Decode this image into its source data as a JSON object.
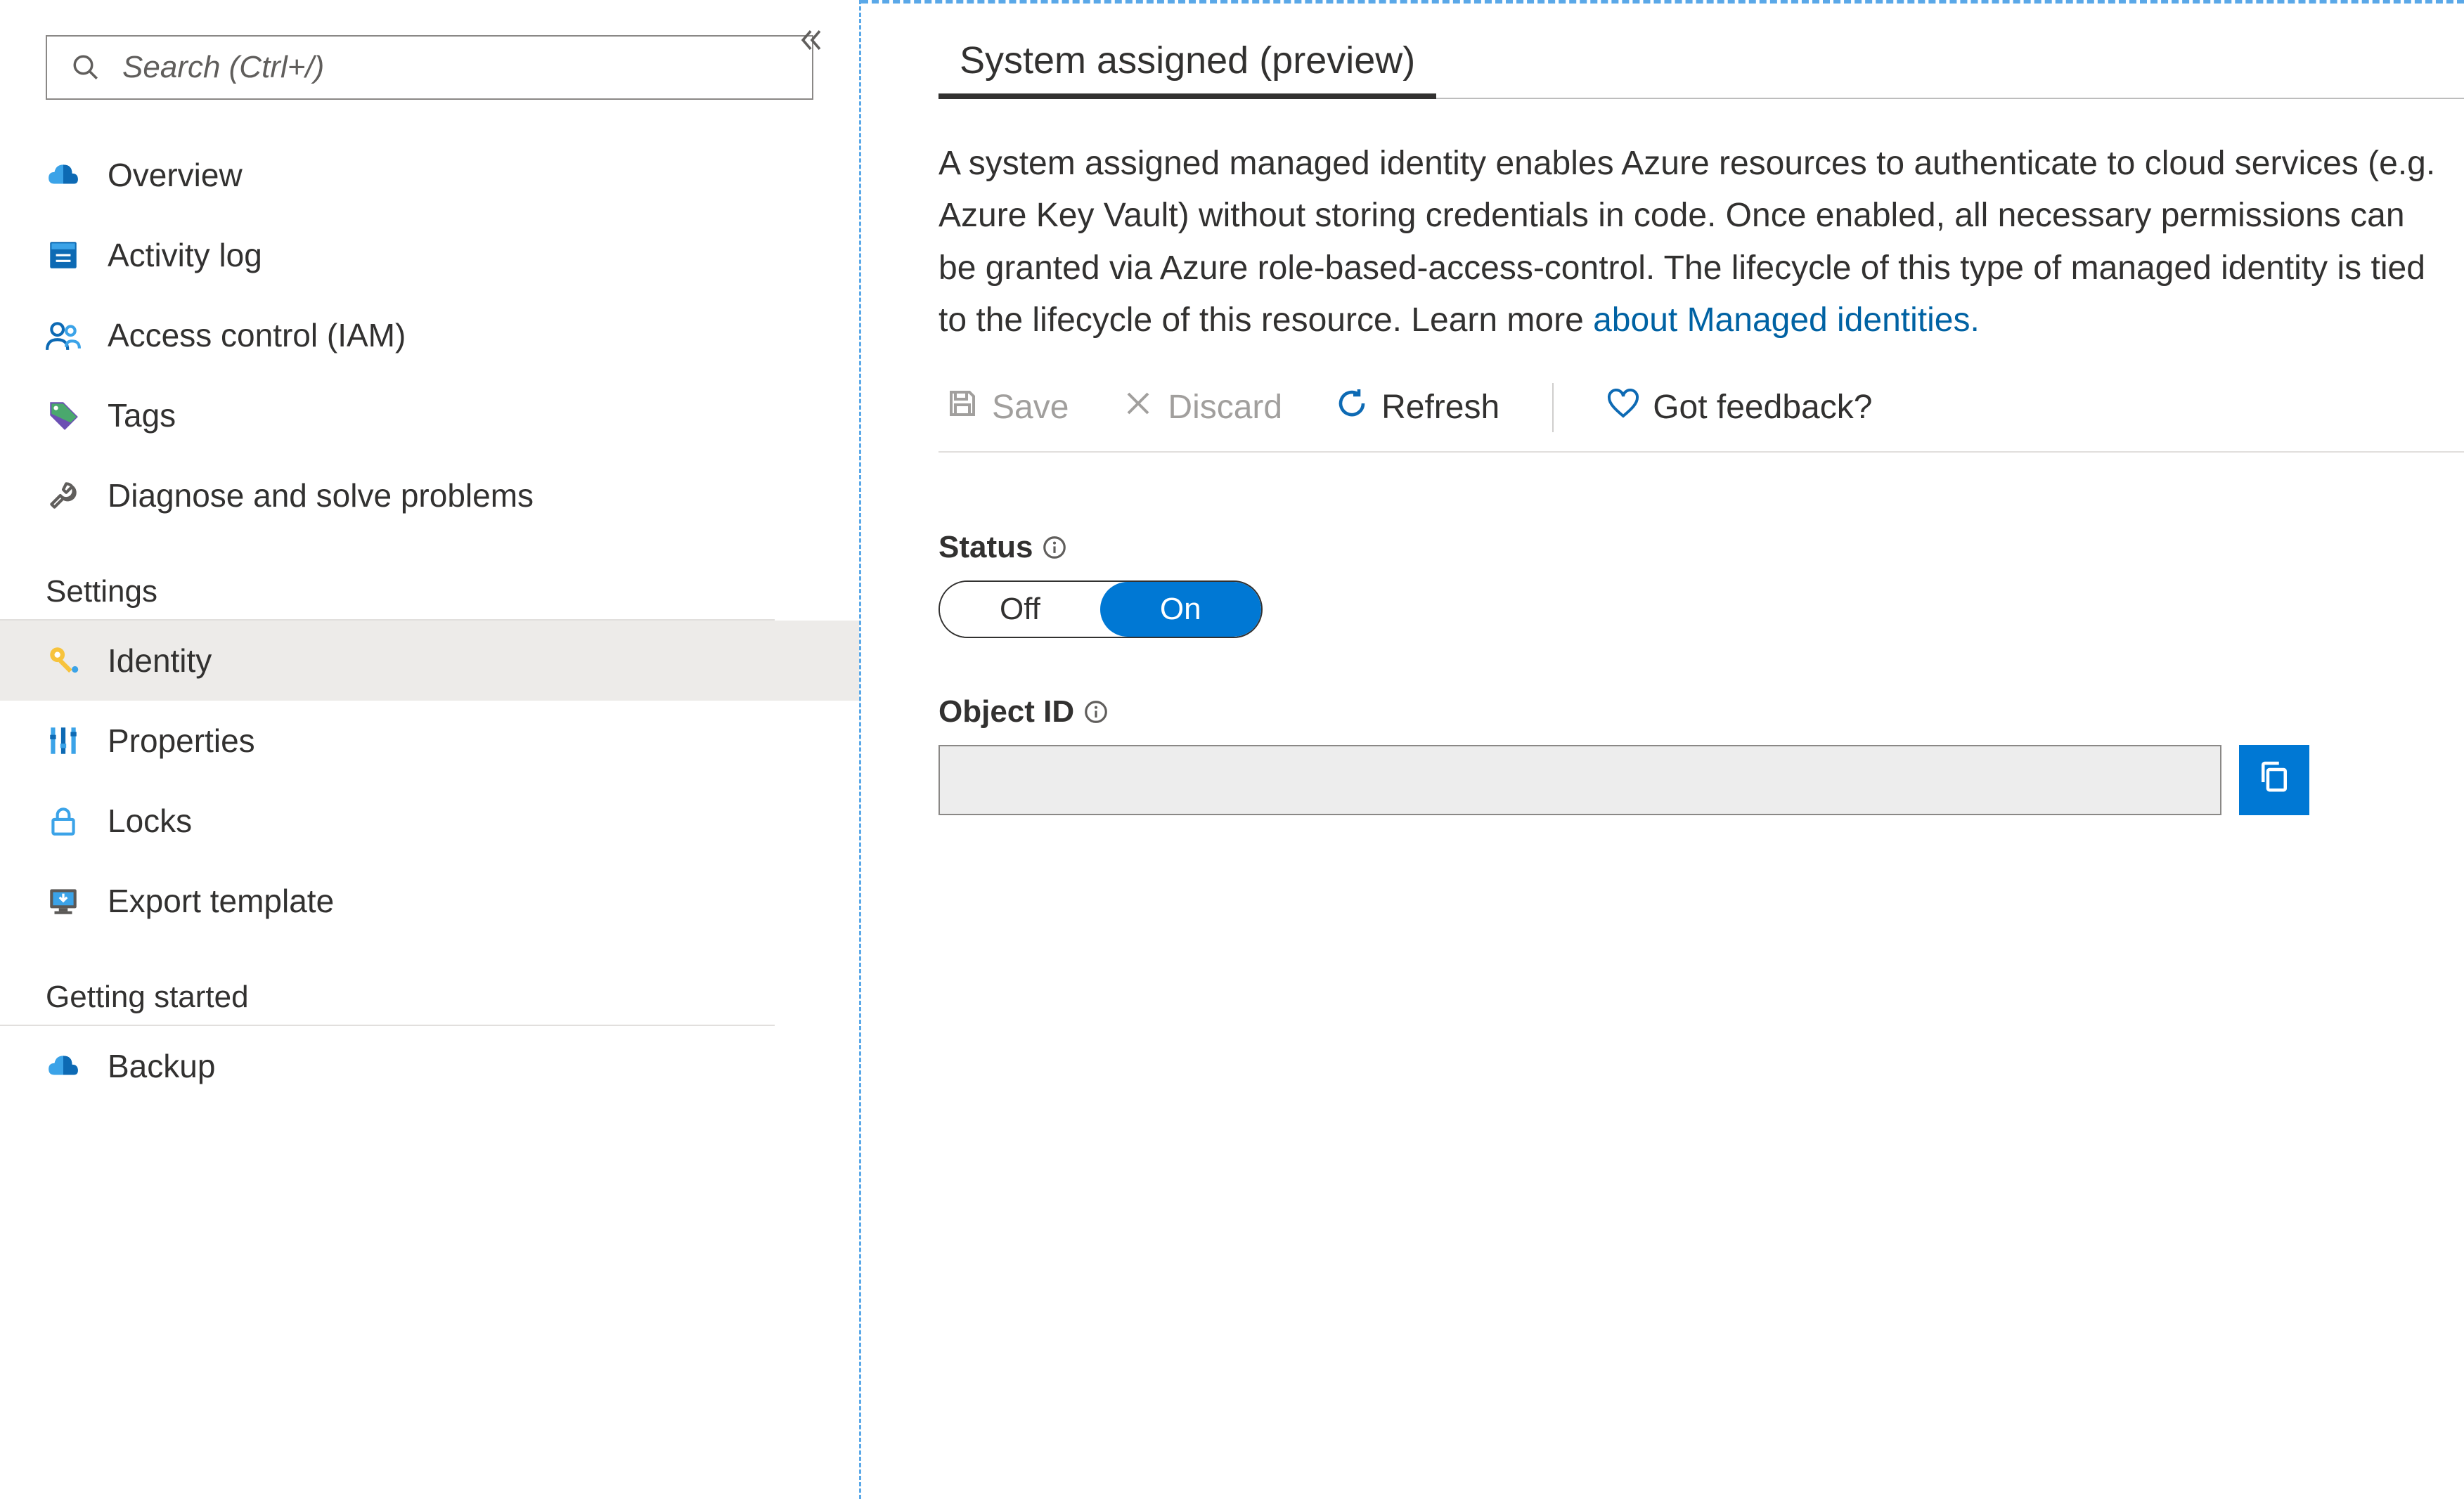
{
  "search": {
    "placeholder": "Search (Ctrl+/)"
  },
  "sidebar": {
    "topItems": [
      {
        "label": "Overview",
        "icon": "cloud"
      },
      {
        "label": "Activity log",
        "icon": "log"
      },
      {
        "label": "Access control (IAM)",
        "icon": "people"
      },
      {
        "label": "Tags",
        "icon": "tag"
      },
      {
        "label": "Diagnose and solve problems",
        "icon": "wrench"
      }
    ],
    "groups": [
      {
        "label": "Settings",
        "items": [
          {
            "label": "Identity",
            "icon": "key",
            "selected": true
          },
          {
            "label": "Properties",
            "icon": "sliders"
          },
          {
            "label": "Locks",
            "icon": "lock"
          },
          {
            "label": "Export template",
            "icon": "download"
          }
        ]
      },
      {
        "label": "Getting started",
        "items": [
          {
            "label": "Backup",
            "icon": "cloud"
          }
        ]
      }
    ]
  },
  "main": {
    "tabs": [
      {
        "label": "System assigned (preview)",
        "active": true
      }
    ],
    "description_pre": "A system assigned managed identity enables Azure resources to authenticate to cloud services (e.g. Azure Key Vault) without storing credentials in code. Once enabled, all necessary permissions can be granted via Azure role-based-access-control. The lifecycle of this type of managed identity is tied to the lifecycle of this resource. Learn more ",
    "description_link": "about Managed identities.",
    "toolbar": {
      "save": "Save",
      "discard": "Discard",
      "refresh": "Refresh",
      "feedback": "Got feedback?"
    },
    "status": {
      "label": "Status",
      "off": "Off",
      "on": "On",
      "value": "On"
    },
    "objectId": {
      "label": "Object ID",
      "value": ""
    }
  }
}
